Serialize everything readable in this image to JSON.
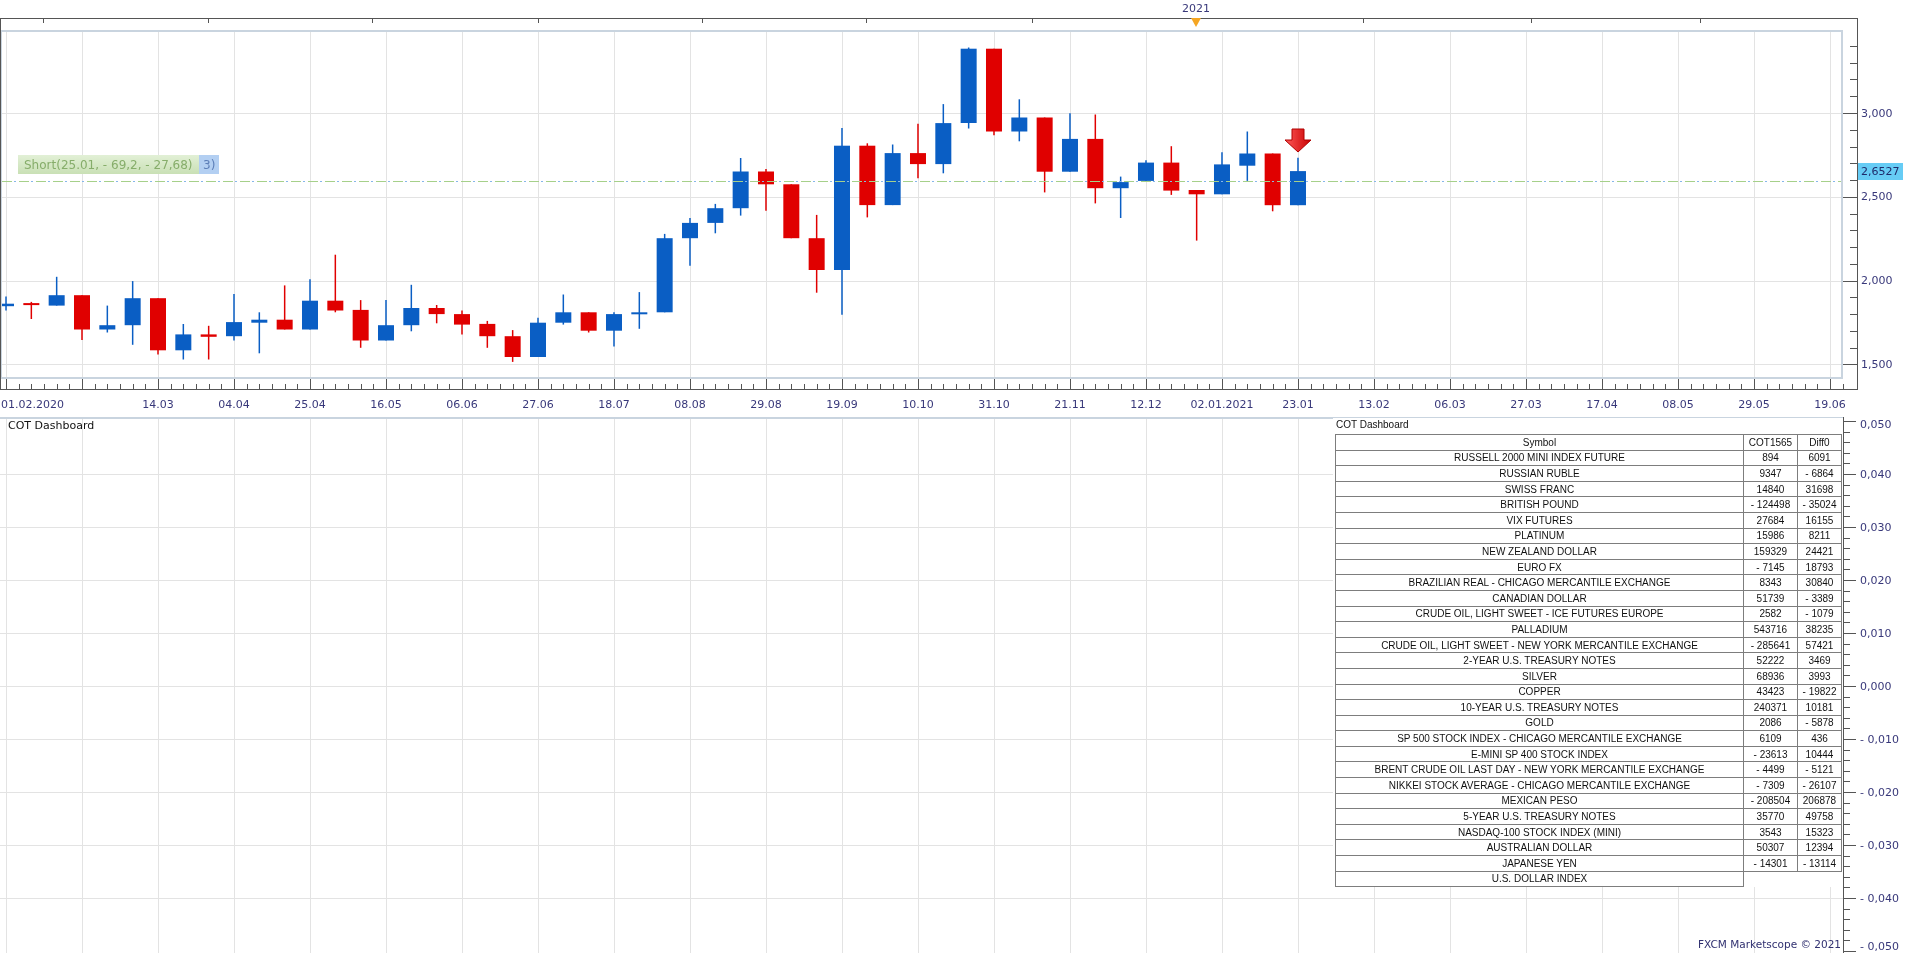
{
  "price_chart": {
    "year_marker": "2021",
    "signal_label": "Short(25.01, - 69,2, - 27,68)",
    "overlapped_label": "3)",
    "current_price": "2,6527",
    "price_ticks": [
      "3,000",
      "2,500",
      "2,000",
      "1,500"
    ],
    "date_ticks": [
      "01.02.2020",
      "14.03",
      "04.04",
      "25.04",
      "16.05",
      "06.06",
      "27.06",
      "18.07",
      "08.08",
      "29.08",
      "19.09",
      "10.10",
      "31.10",
      "21.11",
      "12.12",
      "02.01.2021",
      "23.01",
      "13.02",
      "06.03",
      "27.03",
      "17.04",
      "08.05",
      "29.05",
      "19.06"
    ]
  },
  "cot_panel": {
    "title": "COT Dashboard",
    "value_ticks": [
      "0,050",
      "0,040",
      "0,030",
      "0,020",
      "0,010",
      "0,000",
      "- 0,010",
      "- 0,020",
      "- 0,030",
      "- 0,040",
      "- 0,050"
    ],
    "table": {
      "title": "COT Dashboard",
      "columns": [
        "Symbol",
        "COT1565",
        "Diff0"
      ],
      "rows": [
        {
          "symbol": "RUSSELL 2000 MINI INDEX FUTURE",
          "cot": "894",
          "diff": "6091"
        },
        {
          "symbol": "RUSSIAN RUBLE",
          "cot": "9347",
          "diff": "- 6864"
        },
        {
          "symbol": "SWISS FRANC",
          "cot": "14840",
          "diff": "31698"
        },
        {
          "symbol": "BRITISH POUND",
          "cot": "- 124498",
          "diff": "- 35024"
        },
        {
          "symbol": "VIX FUTURES",
          "cot": "27684",
          "diff": "16155"
        },
        {
          "symbol": "PLATINUM",
          "cot": "15986",
          "diff": "8211"
        },
        {
          "symbol": "NEW ZEALAND DOLLAR",
          "cot": "159329",
          "diff": "24421"
        },
        {
          "symbol": "EURO FX",
          "cot": "- 7145",
          "diff": "18793"
        },
        {
          "symbol": "BRAZILIAN REAL - CHICAGO MERCANTILE EXCHANGE",
          "cot": "8343",
          "diff": "30840"
        },
        {
          "symbol": "CANADIAN DOLLAR",
          "cot": "51739",
          "diff": "- 3389"
        },
        {
          "symbol": "CRUDE OIL, LIGHT SWEET - ICE FUTURES EUROPE",
          "cot": "2582",
          "diff": "- 1079"
        },
        {
          "symbol": "PALLADIUM",
          "cot": "543716",
          "diff": "38235"
        },
        {
          "symbol": "CRUDE OIL, LIGHT SWEET - NEW YORK MERCANTILE EXCHANGE",
          "cot": "- 285641",
          "diff": "57421"
        },
        {
          "symbol": "2-YEAR U.S. TREASURY NOTES",
          "cot": "52222",
          "diff": "3469"
        },
        {
          "symbol": "SILVER",
          "cot": "68936",
          "diff": "3993"
        },
        {
          "symbol": "COPPER",
          "cot": "43423",
          "diff": "- 19822"
        },
        {
          "symbol": "10-YEAR U.S. TREASURY NOTES",
          "cot": "240371",
          "diff": "10181"
        },
        {
          "symbol": "GOLD",
          "cot": "2086",
          "diff": "- 5878"
        },
        {
          "symbol": "SP 500 STOCK INDEX - CHICAGO MERCANTILE EXCHANGE",
          "cot": "6109",
          "diff": "436"
        },
        {
          "symbol": "E-MINI SP 400 STOCK INDEX",
          "cot": "- 23613",
          "diff": "10444"
        },
        {
          "symbol": "BRENT CRUDE OIL LAST DAY - NEW YORK MERCANTILE EXCHANGE",
          "cot": "- 4499",
          "diff": "- 5121"
        },
        {
          "symbol": "NIKKEI STOCK AVERAGE - CHICAGO MERCANTILE EXCHANGE",
          "cot": "- 7309",
          "diff": "- 26107"
        },
        {
          "symbol": "MEXICAN PESO",
          "cot": "- 208504",
          "diff": "206878"
        },
        {
          "symbol": "5-YEAR U.S. TREASURY NOTES",
          "cot": "35770",
          "diff": "49758"
        },
        {
          "symbol": "NASDAQ-100 STOCK INDEX (MINI)",
          "cot": "3543",
          "diff": "15323"
        },
        {
          "symbol": "AUSTRALIAN DOLLAR",
          "cot": "50307",
          "diff": "12394"
        },
        {
          "symbol": "JAPANESE YEN",
          "cot": "- 14301",
          "diff": "- 13114"
        },
        {
          "symbol": "U.S. DOLLAR INDEX"
        }
      ]
    },
    "footer": "FXCM Marketscope © 2021"
  }
}
